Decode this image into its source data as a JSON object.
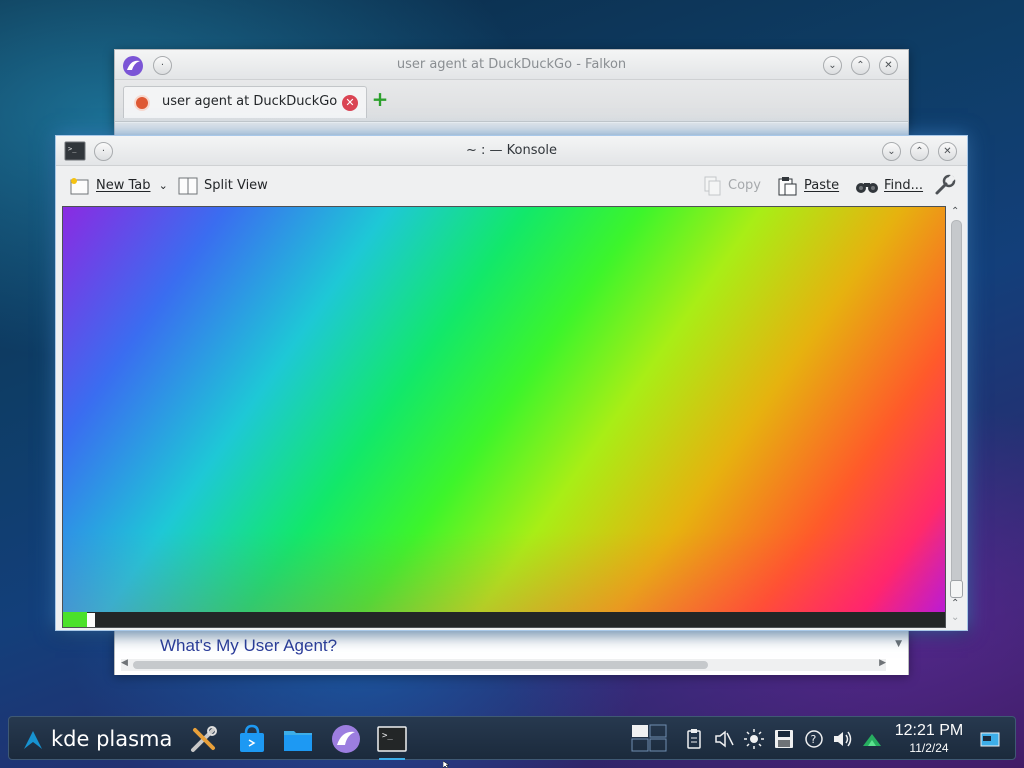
{
  "falkon": {
    "title": "user agent at DuckDuckGo - Falkon",
    "tab_label": "user agent at DuckDuckGo",
    "page_heading": "What's My User Agent?",
    "min_glyph": "⌄",
    "max_glyph": "⌃",
    "close_glyph": "✕",
    "tab_close_glyph": "✕",
    "new_tab_glyph": "+"
  },
  "konsole": {
    "title": "~ : — Konsole",
    "min_glyph": "⌄",
    "max_glyph": "⌃",
    "close_glyph": "✕",
    "toolbar": {
      "new_tab": "New Tab",
      "split_view": "Split View",
      "copy": "Copy",
      "paste": "Paste",
      "find": "Find..."
    }
  },
  "taskbar": {
    "launcher_label": "kde plasma",
    "time": "12:21 PM",
    "date": "11/2/24",
    "tasks": [
      "system-settings-icon",
      "discover-store-icon",
      "dolphin-file-manager-icon",
      "falkon-browser-icon",
      "konsole-terminal-icon"
    ],
    "tray": [
      "pager-icon",
      "clipboard-icon",
      "mute-icon",
      "brightness-icon",
      "save-icon",
      "help-icon",
      "volume-icon",
      "network-icon",
      "show-desktop-icon"
    ]
  },
  "colors": {
    "accent": "#3daee9",
    "taskbar_bg": "#1b2a3c",
    "window_bg": "#eff0f1"
  }
}
